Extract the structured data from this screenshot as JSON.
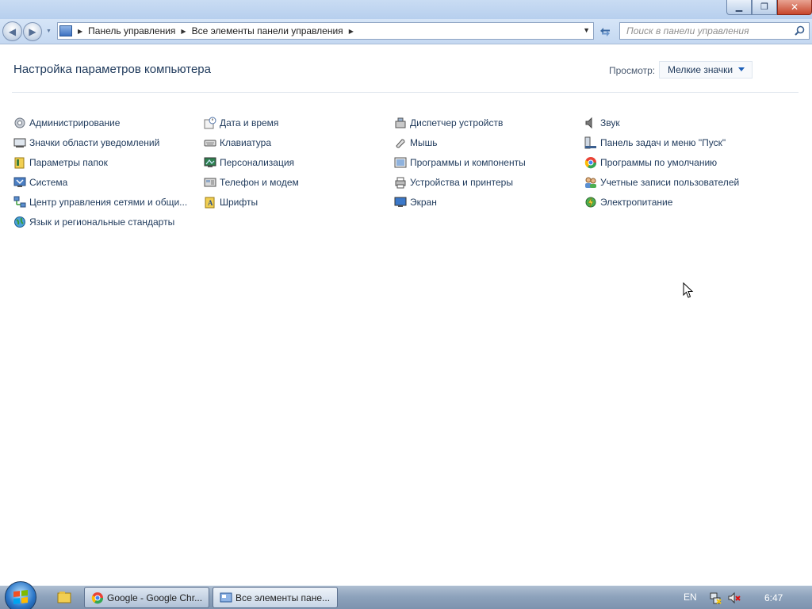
{
  "window": {
    "minimize_glyph": "▁",
    "maximize_glyph": "❐",
    "close_glyph": "✕"
  },
  "navigation": {
    "breadcrumb": [
      "Панель управления",
      "Все элементы панели управления"
    ],
    "search_placeholder": "Поиск в панели управления"
  },
  "header": {
    "title": "Настройка параметров компьютера",
    "view_label": "Просмотр:",
    "view_value": "Мелкие значки"
  },
  "items": [
    {
      "label": "Администрирование",
      "icon": "admin-tools-icon"
    },
    {
      "label": "Значки области уведомлений",
      "icon": "notification-icons-icon"
    },
    {
      "label": "Параметры папок",
      "icon": "folder-options-icon"
    },
    {
      "label": "Система",
      "icon": "system-icon"
    },
    {
      "label": "Центр управления сетями и общи...",
      "icon": "network-center-icon"
    },
    {
      "label": "Язык и региональные стандарты",
      "icon": "region-language-icon"
    },
    {
      "label": "Дата и время",
      "icon": "date-time-icon"
    },
    {
      "label": "Клавиатура",
      "icon": "keyboard-icon"
    },
    {
      "label": "Персонализация",
      "icon": "personalization-icon"
    },
    {
      "label": "Телефон и модем",
      "icon": "phone-modem-icon"
    },
    {
      "label": "Шрифты",
      "icon": "fonts-icon"
    },
    {
      "label": "Диспетчер устройств",
      "icon": "device-manager-icon"
    },
    {
      "label": "Мышь",
      "icon": "mouse-icon"
    },
    {
      "label": "Программы и компоненты",
      "icon": "programs-features-icon"
    },
    {
      "label": "Устройства и принтеры",
      "icon": "devices-printers-icon"
    },
    {
      "label": "Экран",
      "icon": "display-icon"
    },
    {
      "label": "Звук",
      "icon": "sound-icon"
    },
    {
      "label": "Панель задач и меню \"Пуск\"",
      "icon": "taskbar-start-icon"
    },
    {
      "label": "Программы по умолчанию",
      "icon": "default-programs-icon"
    },
    {
      "label": "Учетные записи пользователей",
      "icon": "user-accounts-icon"
    },
    {
      "label": "Электропитание",
      "icon": "power-options-icon"
    }
  ],
  "taskbar": {
    "buttons": [
      {
        "label": "Google - Google Chr...",
        "icon": "chrome-icon"
      },
      {
        "label": "Все элементы пане...",
        "icon": "control-panel-icon"
      }
    ],
    "language": "EN",
    "clock": "6:47"
  }
}
